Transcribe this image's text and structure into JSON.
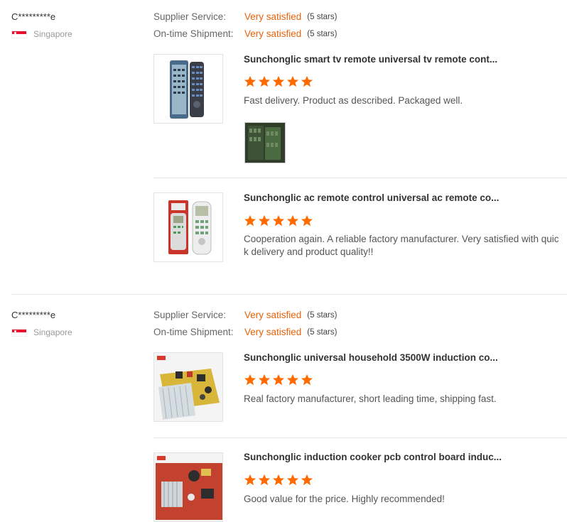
{
  "reviews": [
    {
      "reviewer": {
        "name": "C*********e",
        "country": "Singapore"
      },
      "ratings": [
        {
          "label": "Supplier Service:",
          "value": "Very satisfied",
          "stars_text": "(5 stars)"
        },
        {
          "label": "On-time Shipment:",
          "value": "Very satisfied",
          "stars_text": "(5 stars)"
        }
      ],
      "products": [
        {
          "title": "Sunchonglic smart tv remote universal tv remote cont...",
          "rating": 5,
          "text": "Fast delivery. Product as described. Packaged well.",
          "has_photo": true
        },
        {
          "title": "Sunchonglic ac remote control universal ac remote co...",
          "rating": 5,
          "text": "Cooperation again. A reliable factory manufacturer. Very satisfied with quick delivery and product quality!!",
          "has_photo": false
        }
      ]
    },
    {
      "reviewer": {
        "name": "C*********e",
        "country": "Singapore"
      },
      "ratings": [
        {
          "label": "Supplier Service:",
          "value": "Very satisfied",
          "stars_text": "(5 stars)"
        },
        {
          "label": "On-time Shipment:",
          "value": "Very satisfied",
          "stars_text": "(5 stars)"
        }
      ],
      "products": [
        {
          "title": "Sunchonglic universal household 3500W induction co...",
          "rating": 5,
          "text": "Real factory manufacturer, short leading time, shipping fast.",
          "has_photo": false
        },
        {
          "title": "Sunchonglic induction cooker pcb control board induc...",
          "rating": 5,
          "text": "Good value for the price. Highly recommended!",
          "has_photo": false
        }
      ]
    }
  ],
  "colors": {
    "accent": "#e8630a",
    "star": "#ff6a00",
    "divider": "#e6e6e6"
  }
}
